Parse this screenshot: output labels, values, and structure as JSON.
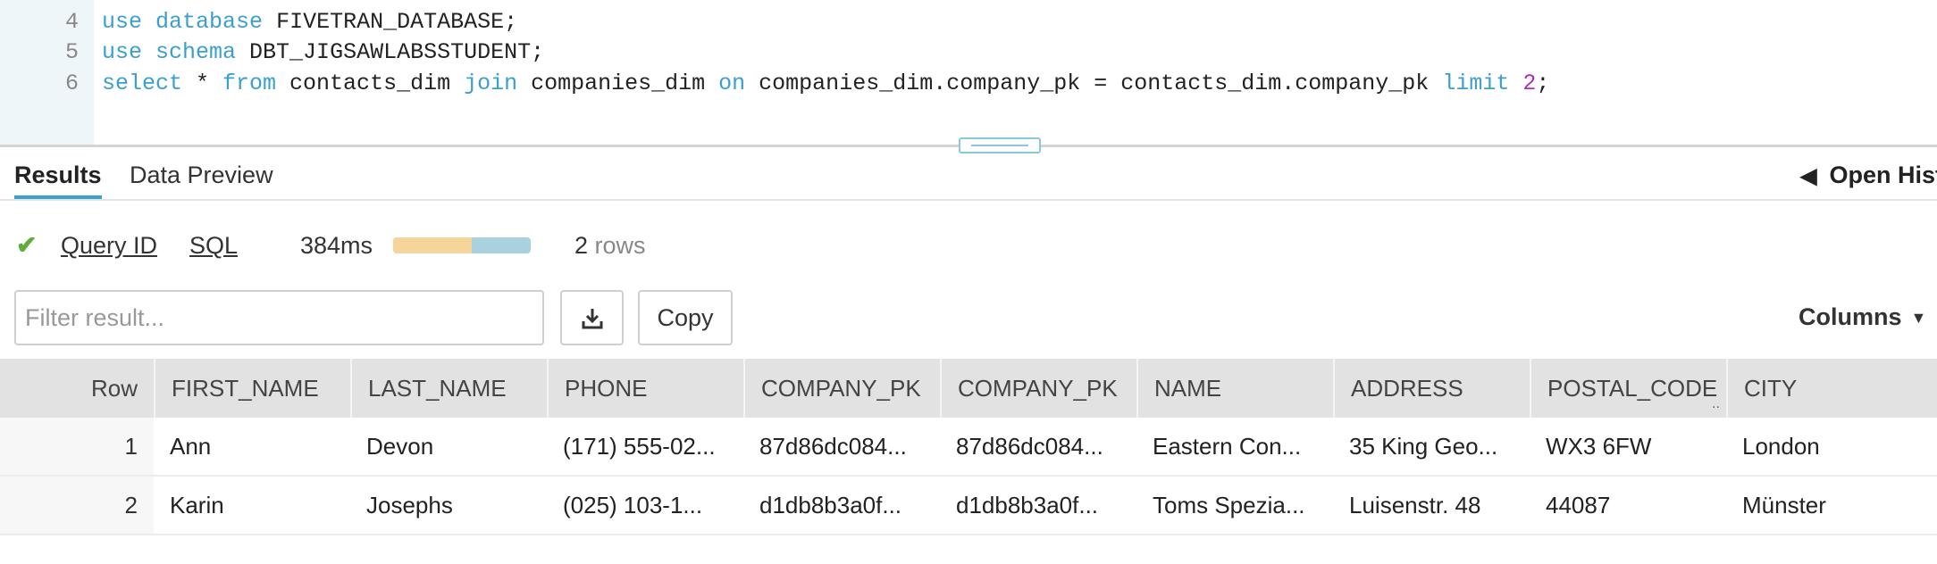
{
  "editor": {
    "lines": [
      {
        "num": "4",
        "parts": [
          {
            "t": "use",
            "k": "kw"
          },
          {
            "t": " "
          },
          {
            "t": "database",
            "k": "kw"
          },
          {
            "t": " FIVETRAN_DATABASE;"
          }
        ]
      },
      {
        "num": "5",
        "parts": [
          {
            "t": "use",
            "k": "kw"
          },
          {
            "t": " "
          },
          {
            "t": "schema",
            "k": "kw"
          },
          {
            "t": " DBT_JIGSAWLABSSTUDENT;"
          }
        ]
      },
      {
        "num": "6",
        "parts": [
          {
            "t": "select",
            "k": "kw"
          },
          {
            "t": " * "
          },
          {
            "t": "from",
            "k": "kw"
          },
          {
            "t": " contacts_dim "
          },
          {
            "t": "join",
            "k": "kw"
          },
          {
            "t": " companies_dim "
          },
          {
            "t": "on",
            "k": "kw"
          },
          {
            "t": " companies_dim.company_pk = contacts_dim.company_pk "
          },
          {
            "t": "limit",
            "k": "kw"
          },
          {
            "t": " "
          },
          {
            "t": "2",
            "k": "num"
          },
          {
            "t": ";"
          }
        ]
      }
    ]
  },
  "tabs": {
    "results": "Results",
    "data_preview": "Data Preview",
    "open_history": "Open History"
  },
  "status": {
    "query_id": "Query ID",
    "sql": "SQL",
    "duration": "384ms",
    "duration_split": 0.57,
    "row_count": "2",
    "rows_label": "rows"
  },
  "toolbar": {
    "filter_placeholder": "Filter result...",
    "download_icon": "download-icon",
    "copy_label": "Copy",
    "columns_label": "Columns"
  },
  "table": {
    "columns": [
      "Row",
      "FIRST_NAME",
      "LAST_NAME",
      "PHONE",
      "COMPANY_PK",
      "COMPANY_PK",
      "NAME",
      "ADDRESS",
      "POSTAL_CODE",
      "CITY"
    ],
    "rows": [
      [
        "1",
        "Ann",
        "Devon",
        "(171) 555-02...",
        "87d86dc084...",
        "87d86dc084...",
        "Eastern Con...",
        "35 King Geo...",
        "WX3 6FW",
        "London"
      ],
      [
        "2",
        "Karin",
        "Josephs",
        "(025) 103-1...",
        "d1db8b3a0f...",
        "d1db8b3a0f...",
        "Toms Spezia...",
        "Luisenstr. 48",
        "44087",
        "Münster"
      ]
    ]
  },
  "colors": {
    "accent": "#3aa3cc",
    "keyword": "#3b9fcf",
    "number": "#b02fb8",
    "success": "#5fae3c",
    "bar_primary": "#f5d59b",
    "bar_secondary": "#a9d2de"
  }
}
